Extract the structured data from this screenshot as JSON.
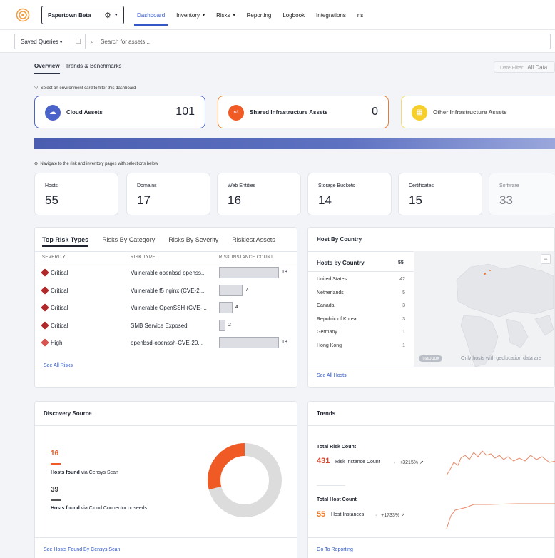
{
  "header": {
    "org_name": "Papertown Beta",
    "nav": [
      {
        "label": "Dashboard",
        "caret": false,
        "active": true
      },
      {
        "label": "Inventory",
        "caret": true
      },
      {
        "label": "Risks",
        "caret": true
      },
      {
        "label": "Reporting",
        "caret": false
      },
      {
        "label": "Logbook",
        "caret": false
      },
      {
        "label": "Integrations",
        "caret": false
      },
      {
        "label": "ns",
        "caret": false
      }
    ]
  },
  "search": {
    "saved_queries": "Saved Queries",
    "placeholder": "Search for assets..."
  },
  "subtabs": {
    "overview": "Overview",
    "trends": "Trends & Benchmarks"
  },
  "date_filter": {
    "label": "Date Filter:",
    "value": "All Data"
  },
  "env": {
    "hint": "Select an environment card to filter this dashboard",
    "cards": [
      {
        "label": "Cloud Assets",
        "count": "101",
        "border": "#4a63c8",
        "icon_bg": "#4a63c8",
        "icon": "cloud-icon"
      },
      {
        "label": "Shared Infrastructure Assets",
        "count": "0",
        "border": "#f07a2a",
        "icon_bg": "#f05a24",
        "icon": "share-icon"
      },
      {
        "label": "Other Infrastructure Assets",
        "count": "",
        "border": "#f3dc6a",
        "icon_bg": "#f6cf2a",
        "icon": "building-icon"
      }
    ]
  },
  "navigate_hint": "Navigate to the risk and inventory pages with selections below",
  "stats": [
    {
      "label": "Hosts",
      "value": "55"
    },
    {
      "label": "Domains",
      "value": "17"
    },
    {
      "label": "Web Entities",
      "value": "16"
    },
    {
      "label": "Storage Buckets",
      "value": "14"
    },
    {
      "label": "Certificates",
      "value": "15"
    },
    {
      "label": "Software",
      "value": "33"
    }
  ],
  "risks": {
    "tabs": [
      "Top Risk Types",
      "Risks By Category",
      "Risks By Severity",
      "Riskiest Assets"
    ],
    "columns": [
      "SEVERITY",
      "RISK TYPE",
      "RISK INSTANCE COUNT"
    ],
    "rows": [
      {
        "severity": "Critical",
        "type": "Vulnerable openbsd openss...",
        "count": 18
      },
      {
        "severity": "Critical",
        "type": "Vulnerable f5 nginx (CVE-2...",
        "count": 7
      },
      {
        "severity": "Critical",
        "type": "Vulnerable OpenSSH (CVE-...",
        "count": 4
      },
      {
        "severity": "Critical",
        "type": "SMB Service Exposed",
        "count": 2
      },
      {
        "severity": "High",
        "type": "openbsd-openssh-CVE-20...",
        "count": 18
      }
    ],
    "link": "See All Risks"
  },
  "country": {
    "panel_title": "Host By Country",
    "list_title": "Hosts by Country",
    "total": "55",
    "rows": [
      {
        "name": "United States",
        "count": "42"
      },
      {
        "name": "Netherlands",
        "count": "5"
      },
      {
        "name": "Canada",
        "count": "3"
      },
      {
        "name": "Republic of Korea",
        "count": "3"
      },
      {
        "name": "Germany",
        "count": "1"
      },
      {
        "name": "Hong Kong",
        "count": "1"
      }
    ],
    "map_brand": "mapbox",
    "map_note": "Only hosts with geolocation data are",
    "link": "See All Hosts"
  },
  "discovery": {
    "title": "Discovery Source",
    "censys_count": "16",
    "censys_label_bold": "Hosts found",
    "censys_label": "via Censys Scan",
    "connector_count": "39",
    "connector_label_bold": "Hosts found",
    "connector_label": "via Cloud Connector or seeds",
    "link": "See Hosts Found By Censys Scan",
    "colors": {
      "censys": "#f05a24",
      "connector": "#dcdcdc"
    }
  },
  "trends": {
    "title": "Trends",
    "risk_title": "Total Risk Count",
    "risk_value": "431",
    "risk_unit": "Risk Instance Count",
    "risk_pct": "+3215%",
    "host_title": "Total Host Count",
    "host_value": "55",
    "host_unit": "Host Instances",
    "host_pct": "+1733%",
    "link": "Go To Reporting"
  }
}
